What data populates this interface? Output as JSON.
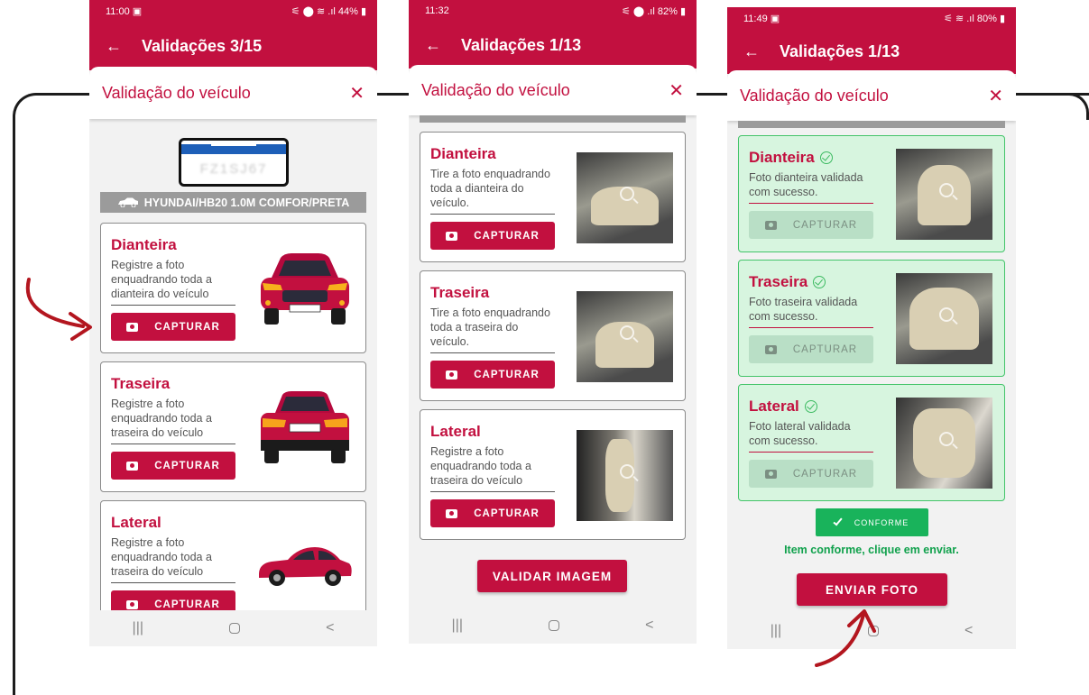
{
  "p1": {
    "status_time": "11:00 ▣",
    "status_right": "⚟ ⬤ ≋ .ıl 44% ▮",
    "appbar_title": "Validações 3/15",
    "sheet_title": "Validação do veículo",
    "plate": "FZ1SJ67",
    "vehicle_model": "HYUNDAI/HB20 1.0M COMFOR/PRETA",
    "cards": [
      {
        "title": "Dianteira",
        "desc": "Registre a foto enquadrando toda a dianteira do veículo",
        "button": "CAPTURAR"
      },
      {
        "title": "Traseira",
        "desc": "Registre a foto enquadrando toda a traseira do veículo",
        "button": "CAPTURAR"
      },
      {
        "title": "Lateral",
        "desc": "Registre a foto enquadrando toda a traseira do veículo",
        "button": "CAPTURAR"
      }
    ]
  },
  "p2": {
    "status_time": "11:32",
    "status_right": "⚟ ⬤ .ıl 82% ▮",
    "appbar_title": "Validações 1/13",
    "sheet_title": "Validação do veículo",
    "cards": [
      {
        "title": "Dianteira",
        "desc": "Tire a foto enquadrando toda a dianteira do veículo.",
        "button": "CAPTURAR"
      },
      {
        "title": "Traseira",
        "desc": "Tire a foto enquadrando toda a traseira do veículo.",
        "button": "CAPTURAR"
      },
      {
        "title": "Lateral",
        "desc": "Registre a foto enquadrando toda a traseira do veículo",
        "button": "CAPTURAR"
      }
    ],
    "validate_button": "VALIDAR IMAGEM"
  },
  "p3": {
    "status_time": "11:49 ▣",
    "status_right": "⚟ ≋ .ıl 80% ▮",
    "appbar_title": "Validações 1/13",
    "sheet_title": "Validação do veículo",
    "cards": [
      {
        "title": "Dianteira",
        "desc": "Foto dianteira validada com sucesso.",
        "button": "CAPTURAR"
      },
      {
        "title": "Traseira",
        "desc": "Foto traseira validada com sucesso.",
        "button": "CAPTURAR"
      },
      {
        "title": "Lateral",
        "desc": "Foto lateral validada com sucesso.",
        "button": "CAPTURAR"
      }
    ],
    "conforme_label": "CONFORME",
    "conforme_message": "Item conforme, clique em enviar.",
    "send_button": "ENVIAR FOTO"
  },
  "nav": {
    "recents": "|||",
    "back": "<"
  },
  "icons": {
    "back": "←",
    "close": "✕"
  },
  "colors": {
    "brand": "#c2103f",
    "success": "#19b35b",
    "arrow": "#b3161f"
  }
}
